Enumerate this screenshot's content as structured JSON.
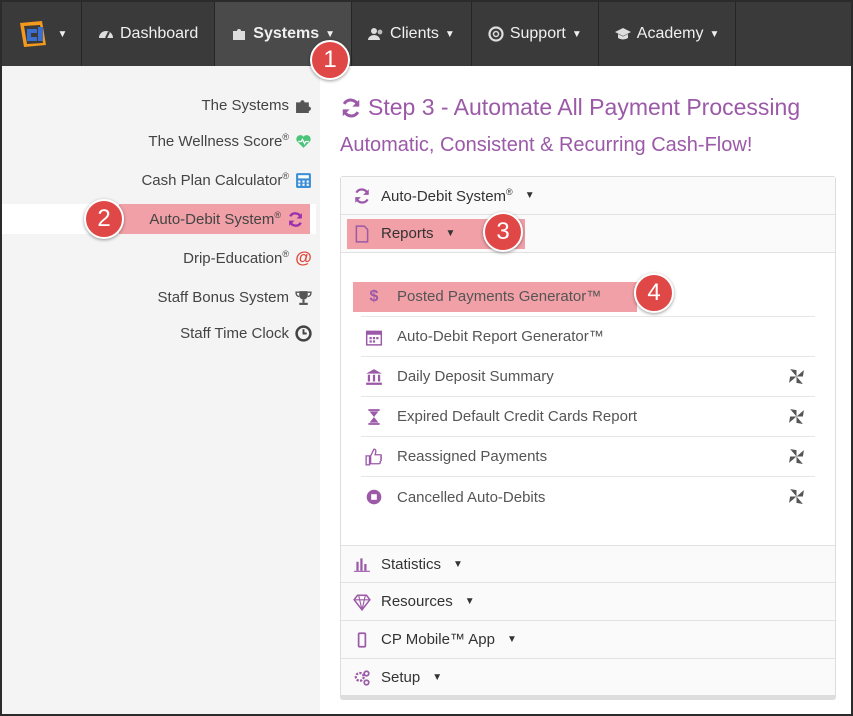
{
  "nav": {
    "dashboard": "Dashboard",
    "systems": "Systems",
    "clients": "Clients",
    "support": "Support",
    "academy": "Academy"
  },
  "sidebar": {
    "items": [
      {
        "label": "The Systems",
        "icon": "puzzle-icon"
      },
      {
        "label": "The Wellness Score",
        "icon": "heart-pulse-icon",
        "reg": "®"
      },
      {
        "label": "Cash Plan Calculator",
        "icon": "calculator-icon",
        "reg": "®"
      },
      {
        "label": "Auto-Debit System",
        "icon": "refresh-icon",
        "reg": "®"
      },
      {
        "label": "Drip-Education",
        "icon": "at-sign-icon",
        "reg": "®"
      },
      {
        "label": "Staff Bonus System",
        "icon": "trophy-icon"
      },
      {
        "label": "Staff Time Clock",
        "icon": "clock-icon"
      }
    ]
  },
  "main": {
    "title": "Step 3 - Automate All Payment Processing",
    "subtitle": "Automatic, Consistent & Recurring Cash-Flow!",
    "sections": {
      "auto_debit": "Auto-Debit System",
      "reg": "®",
      "reports": "Reports",
      "statistics": "Statistics",
      "resources": "Resources",
      "mobile": "CP Mobile™ App",
      "setup": "Setup"
    },
    "reports": [
      {
        "label": "Posted Payments Generator™",
        "icon": "dollar-icon"
      },
      {
        "label": "Auto-Debit Report Generator™",
        "icon": "calendar-icon"
      },
      {
        "label": "Daily Deposit Summary",
        "icon": "bank-icon"
      },
      {
        "label": "Expired Default Credit Cards Report",
        "icon": "hourglass-icon"
      },
      {
        "label": "Reassigned Payments",
        "icon": "thumbs-up-icon"
      },
      {
        "label": "Cancelled Auto-Debits",
        "icon": "stop-circle-icon"
      }
    ]
  },
  "callouts": [
    "1",
    "2",
    "3",
    "4"
  ],
  "colors": {
    "accent": "#9b59a8",
    "navbar": "#3a3a3a",
    "highlight": "#f0a0a6",
    "badge": "#e04848"
  }
}
